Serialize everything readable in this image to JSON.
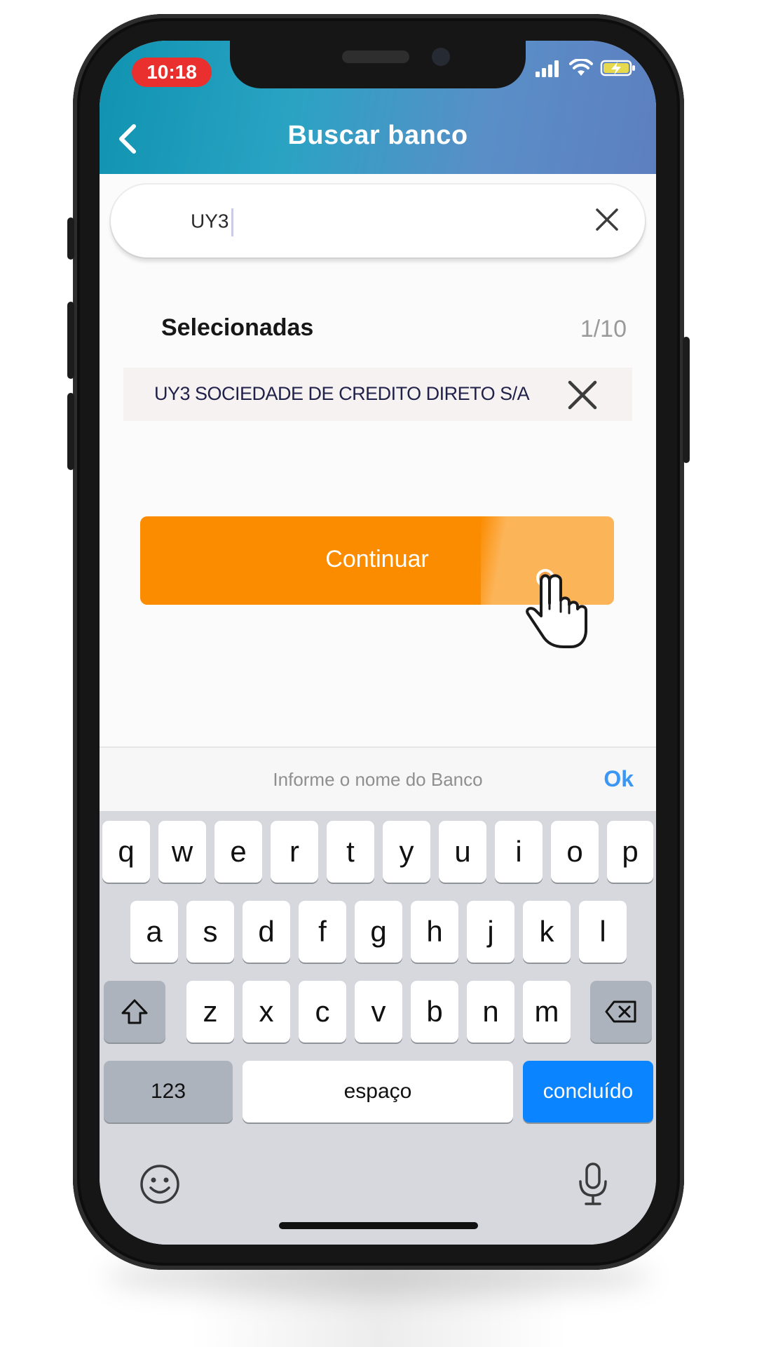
{
  "status_bar": {
    "time": "10:18",
    "icons": [
      "signal-icon",
      "wifi-icon",
      "battery-charging-icon"
    ]
  },
  "header": {
    "title": "Buscar banco",
    "back_icon": "chevron-left-icon",
    "color_start": "#0f93b0",
    "color_end": "#5d7fc0"
  },
  "search": {
    "value": "UY3",
    "clear_icon": "close-icon"
  },
  "selected": {
    "label": "Selecionadas",
    "count": "1/10",
    "items": [
      {
        "name": "UY3 SOCIEDADE DE CREDITO DIRETO S/A",
        "remove_icon": "close-icon"
      }
    ]
  },
  "primary_button": {
    "label": "Continuar",
    "color": "#fb8c00",
    "cursor_icon": "hand-pointer-icon"
  },
  "keyboard_toolbar": {
    "hint": "Informe o nome do Banco",
    "ok_label": "Ok",
    "ok_color": "#3b97f3"
  },
  "keyboard": {
    "row1": [
      "q",
      "w",
      "e",
      "r",
      "t",
      "y",
      "u",
      "i",
      "o",
      "p"
    ],
    "row2": [
      "a",
      "s",
      "d",
      "f",
      "g",
      "h",
      "j",
      "k",
      "l"
    ],
    "row3": [
      "z",
      "x",
      "c",
      "v",
      "b",
      "n",
      "m"
    ],
    "shift_icon": "shift-icon",
    "backspace_icon": "backspace-icon",
    "numbers_label": "123",
    "space_label": "espaço",
    "done_label": "concluído",
    "done_color": "#0a84ff",
    "emoji_icon": "emoji-icon",
    "mic_icon": "microphone-icon"
  }
}
